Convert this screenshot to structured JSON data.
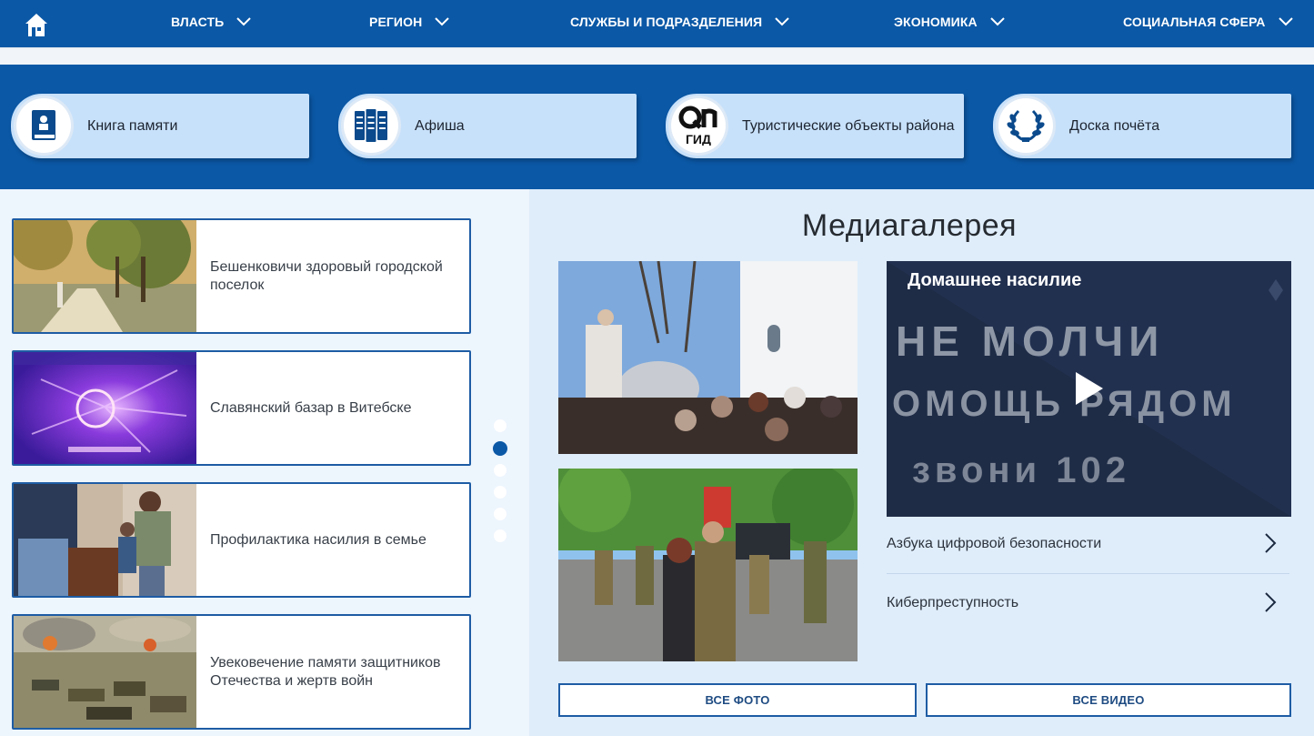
{
  "nav": {
    "items": [
      {
        "label": "ВЛАСТЬ"
      },
      {
        "label": "РЕГИОН"
      },
      {
        "label": "СЛУЖБЫ И ПОДРАЗДЕЛЕНИЯ"
      },
      {
        "label": "ЭКОНОМИКА"
      },
      {
        "label": "СОЦИАЛЬНАЯ СФЕРА"
      }
    ]
  },
  "quick_links": [
    {
      "label": "Книга памяти",
      "icon": "memory-book-icon"
    },
    {
      "label": "Афиша",
      "icon": "poster-icon"
    },
    {
      "label": "Туристические объекты района",
      "icon": "qr-guide-icon",
      "icon_text": "ГИД"
    },
    {
      "label": "Доска почёта",
      "icon": "laurel-wreath-icon"
    }
  ],
  "news": [
    {
      "title": "Бешенковичи здоровый городской поселок"
    },
    {
      "title": "Славянский базар в Витебске"
    },
    {
      "title": "Профилактика насилия в семье"
    },
    {
      "title": "Увековечение памяти защитников Отечества и жертв войн"
    }
  ],
  "slider": {
    "count": 6,
    "active_index": 1
  },
  "gallery": {
    "title": "Медиагалерея",
    "video": {
      "title": "Домашнее насилие",
      "overlay_lines": [
        "НЕ МОЛЧИ",
        "ОМОЩЬ РЯДОМ",
        "звони 102"
      ]
    },
    "video_links": [
      {
        "label": "Азбука цифровой безопасности"
      },
      {
        "label": "Киберпреступность"
      }
    ],
    "all_photos_label": "ВСЕ ФОТО",
    "all_videos_label": "ВСЕ ВИДЕО"
  },
  "colors": {
    "brand": "#0b58a6",
    "card": "#c8e1fa",
    "border": "#1e5ca4"
  }
}
